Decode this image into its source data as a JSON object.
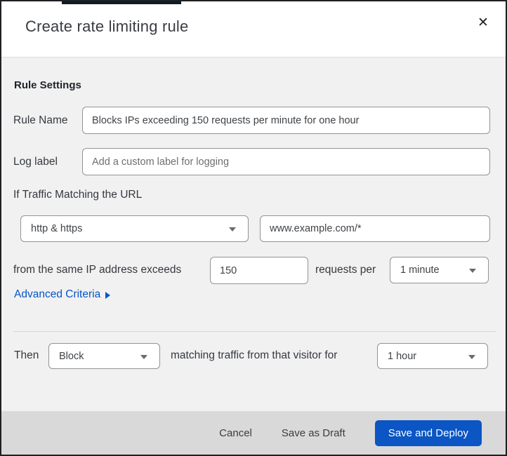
{
  "colors": {
    "accent_blue": "#0b55c4",
    "link_blue": "#0856c5",
    "top_strip": "#0d1b2a",
    "body_bg": "#f1f1f2",
    "footer_bg": "#d9d9d9"
  },
  "dialog": {
    "title": "Create rate limiting rule",
    "close_icon": "✕"
  },
  "rule_settings": {
    "heading": "Rule Settings",
    "rule_name": {
      "label": "Rule Name",
      "value": "Blocks IPs exceeding 150 requests per minute for one hour"
    },
    "log_label": {
      "label": "Log label",
      "placeholder": "Add a custom label for logging"
    }
  },
  "match": {
    "heading": "If Traffic Matching the URL",
    "scheme_select": {
      "value": "http & https"
    },
    "url_input": {
      "value": "www.example.com/*"
    },
    "threshold_prefix": "from the same IP address exceeds",
    "threshold_value": "150",
    "threshold_suffix": "requests per",
    "period_select": {
      "value": "1 minute"
    },
    "advanced_link": "Advanced Criteria"
  },
  "action": {
    "then_label": "Then",
    "action_select": {
      "value": "Block"
    },
    "middle_text": "matching traffic from that visitor for",
    "duration_select": {
      "value": "1 hour"
    }
  },
  "footer": {
    "cancel": "Cancel",
    "save_draft": "Save as Draft",
    "save_deploy": "Save and Deploy"
  }
}
